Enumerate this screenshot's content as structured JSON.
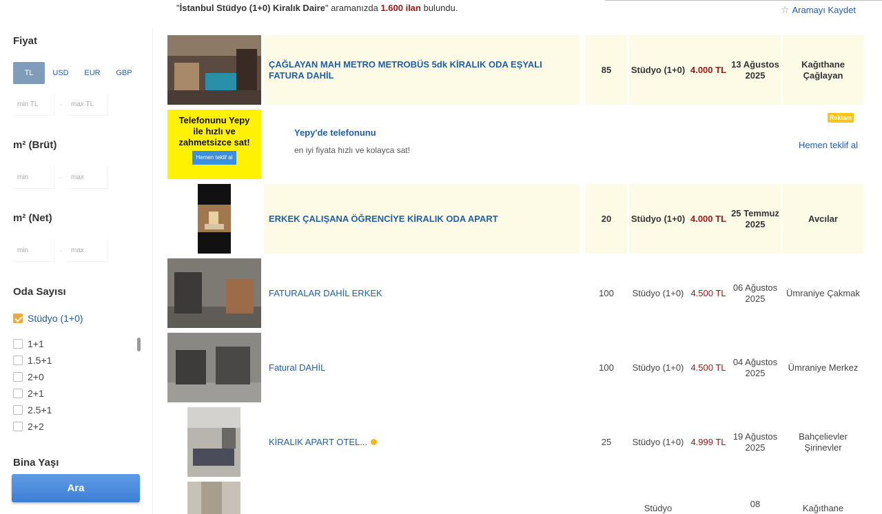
{
  "search_info": {
    "query": "İstanbul Stüdyo (1+0) Kiralık Daire",
    "prefix": "\"",
    "mid": "\" aramanızda ",
    "count": "1.600 ilan",
    "suffix": " bulundu.",
    "save_label": "Aramayı Kaydet"
  },
  "sidebar": {
    "price_title": "Fiyat",
    "currencies": [
      "TL",
      "USD",
      "EUR",
      "GBP"
    ],
    "price_min_placeholder": "min TL",
    "price_max_placeholder": "max TL",
    "m2_gross_title": "m² (Brüt)",
    "m2_net_title": "m² (Net)",
    "min_placeholder": "min",
    "max_placeholder": "max",
    "rooms_title": "Oda Sayısı",
    "rooms": [
      {
        "label": "Stüdyo (1+0)",
        "checked": true
      },
      {
        "label": "1+1",
        "checked": false
      },
      {
        "label": "1.5+1",
        "checked": false
      },
      {
        "label": "2+0",
        "checked": false
      },
      {
        "label": "2+1",
        "checked": false
      },
      {
        "label": "2.5+1",
        "checked": false
      },
      {
        "label": "2+2",
        "checked": false
      }
    ],
    "building_age_title": "Bina Yaşı",
    "search_button": "Ara"
  },
  "ad": {
    "image_text": "Telefonunu Yepy ile hızlı ve zahmetsizce sat!",
    "image_button": "Hemen teklif al",
    "title": "Yepy'de telefonunu",
    "subtitle": "en iyi fiyata hızlı ve kolayca sat!",
    "badge": "Reklam",
    "link": "Hemen teklif al"
  },
  "listings": [
    {
      "title": "ÇAĞLAYAN MAH METRO METROBÜS 5dk KİRALIK ODA EŞYALI FATURA DAHİL",
      "m2": "85",
      "type": "Stüdyo (1+0)",
      "price": "4.000 TL",
      "date": "13 Ağustos 2025",
      "location": "Kağıthane Çağlayan",
      "featured": true
    },
    {
      "title": "ERKEK ÇALIŞANA ÖĞRENCİYE KİRALIK ODA APART",
      "m2": "20",
      "type": "Stüdyo (1+0)",
      "price": "4.000 TL",
      "date": "25 Temmuz 2025",
      "location": "Avcılar",
      "featured": true
    },
    {
      "title": "FATURALAR DAHİL ERKEK",
      "m2": "100",
      "type": "Stüdyo (1+0)",
      "price": "4.500 TL",
      "date": "06 Ağustos 2025",
      "location": "Ümraniye Çakmak",
      "featured": false
    },
    {
      "title": "Fatural DAHİL",
      "m2": "100",
      "type": "Stüdyo (1+0)",
      "price": "4.500 TL",
      "date": "04 Ağustos 2025",
      "location": "Ümraniye Merkez",
      "featured": false
    },
    {
      "title": "KİRALIK APART OTEL...",
      "m2": "25",
      "type": "Stüdyo (1+0)",
      "price": "4.999 TL",
      "date": "19 Ağustos 2025",
      "location": "Bahçelievler Şirinevler",
      "featured": false
    },
    {
      "title": "",
      "m2": "",
      "type": "Stüdyo",
      "price": "",
      "date": "08",
      "location": "Kağıthane",
      "featured": false
    }
  ],
  "colors": {
    "accent_blue": "#1f5ea8",
    "price_red": "#a01818",
    "featured_bg": "#fdfbe6",
    "checkbox_orange": "#f3a63a"
  }
}
